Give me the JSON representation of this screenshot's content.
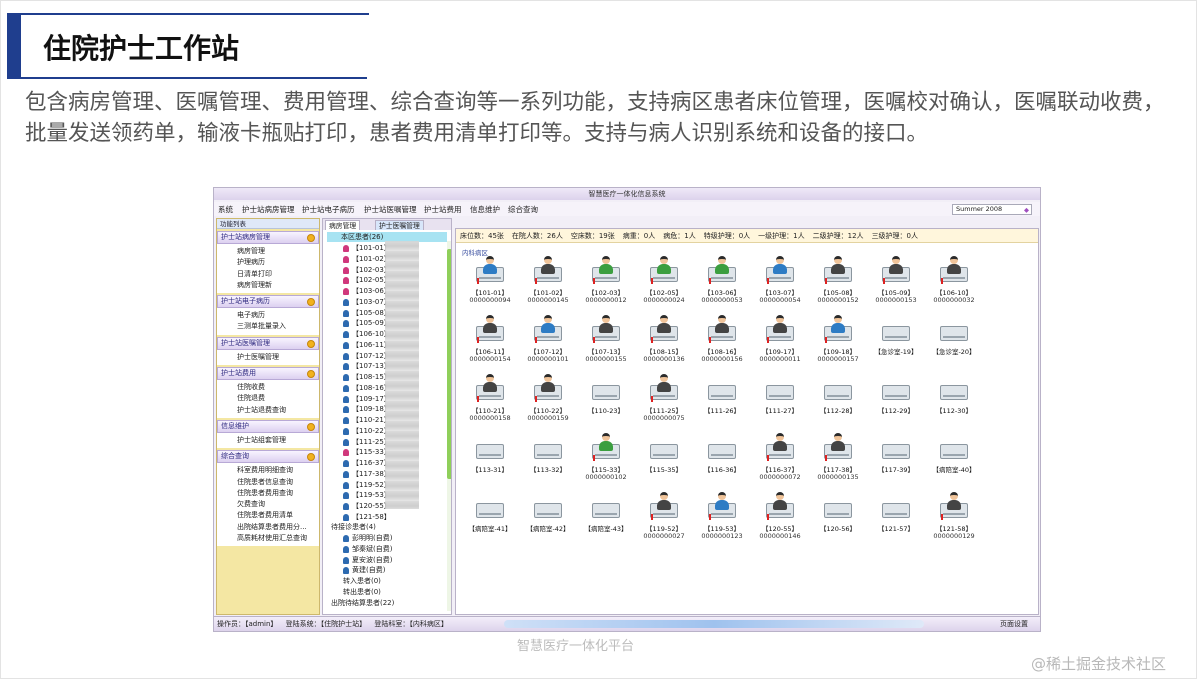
{
  "slide": {
    "title": "住院护士工作站",
    "intro": "包含病房管理、医嘱管理、费用管理、综合查询等一系列功能，支持病区患者床位管理，医嘱校对确认，医嘱联动收费，批量发送领药单，输液卡瓶贴打印，患者费用清单打印等。支持与病人识别系统和设备的接口。",
    "caption": "智慧医疗一体化平台",
    "watermark": "@稀土掘金技术社区"
  },
  "app": {
    "window_title": "智慧医疗一体化信息系统",
    "menu": [
      "系统",
      "护士站病房管理",
      "护士站电子病历",
      "护士站医嘱管理",
      "护士站费用",
      "信息维护",
      "综合查询"
    ],
    "skin_select": "Summer 2008",
    "nav_header": "功能列表",
    "nav_groups": [
      {
        "label": "护士站病房管理",
        "items": [
          "病房管理",
          "护理病历",
          "日清单打印",
          "病房管理新"
        ]
      },
      {
        "label": "护士站电子病历",
        "items": [
          "电子病历",
          "三测单批量录入"
        ]
      },
      {
        "label": "护士站医嘱管理",
        "items": [
          "护士医嘱管理"
        ]
      },
      {
        "label": "护士站费用",
        "items": [
          "住院收费",
          "住院退费",
          "护士站退费查询"
        ]
      },
      {
        "label": "信息维护",
        "items": [
          "护士站组套管理"
        ]
      },
      {
        "label": "综合查询",
        "items": [
          "科室费用明细查询",
          "住院患者信息查询",
          "住院患者费用查询",
          "欠费查询",
          "住院患者费用清单",
          "出院结算患者费用分...",
          "高质耗材使用汇总查询"
        ]
      }
    ],
    "tabs": [
      "病房管理",
      "护士医嘱管理"
    ],
    "tree": {
      "root": "本区患者(26)",
      "patients": [
        {
          "bed": "【101-01】",
          "g": "f"
        },
        {
          "bed": "【101-02】",
          "g": "f"
        },
        {
          "bed": "【102-03】",
          "g": "f"
        },
        {
          "bed": "【102-05】",
          "g": "f"
        },
        {
          "bed": "【103-06】",
          "g": "f"
        },
        {
          "bed": "【103-07】",
          "g": "m"
        },
        {
          "bed": "【105-08】",
          "g": "m"
        },
        {
          "bed": "【105-09】",
          "g": "m"
        },
        {
          "bed": "【106-10】",
          "g": "m"
        },
        {
          "bed": "【106-11】",
          "g": "m"
        },
        {
          "bed": "【107-12】",
          "g": "m"
        },
        {
          "bed": "【107-13】",
          "g": "m"
        },
        {
          "bed": "【108-15】",
          "g": "m"
        },
        {
          "bed": "【108-16】",
          "g": "m"
        },
        {
          "bed": "【109-17】",
          "g": "m"
        },
        {
          "bed": "【109-18】",
          "g": "m"
        },
        {
          "bed": "【110-21】",
          "g": "m"
        },
        {
          "bed": "【110-22】",
          "g": "m"
        },
        {
          "bed": "【111-25】",
          "g": "m"
        },
        {
          "bed": "【115-33】",
          "g": "f"
        },
        {
          "bed": "【116-37】",
          "g": "m"
        },
        {
          "bed": "【117-38】",
          "g": "m"
        },
        {
          "bed": "【119-52】",
          "g": "m"
        },
        {
          "bed": "【119-53】",
          "g": "m"
        },
        {
          "bed": "【120-55】",
          "g": "m"
        },
        {
          "bed": "【121-58】",
          "g": "m"
        }
      ],
      "pending_label": "待接诊患者(4)",
      "pending": [
        "彭明明(自费)",
        "邹秦斌(自费)",
        "夏安波(自费)",
        "黄建(自费)"
      ],
      "transfer_in": "转入患者(0)",
      "transfer_out": "转出患者(0)",
      "discharge": "出院待结算患者(22)"
    },
    "stats": [
      "床位数：45张",
      "在院人数：26人",
      "空床数：19张",
      "病重：0人",
      "病危：1人",
      "特级护理：0人",
      "一级护理：1人",
      "二级护理：12人",
      "三级护理：0人"
    ],
    "ward_label": "内科病区",
    "beds": [
      {
        "label": "【101-01】",
        "code": "0000000094",
        "occ": 2
      },
      {
        "label": "【101-02】",
        "code": "0000000145",
        "occ": 2
      },
      {
        "label": "【102-03】",
        "code": "0000000012",
        "occ": 1
      },
      {
        "label": "【102-05】",
        "code": "0000000024",
        "occ": 1
      },
      {
        "label": "【103-06】",
        "code": "0000000053",
        "occ": 1
      },
      {
        "label": "【103-07】",
        "code": "0000000054",
        "occ": 2
      },
      {
        "label": "【105-08】",
        "code": "0000000152",
        "occ": 2
      },
      {
        "label": "【105-09】",
        "code": "0000000153",
        "occ": 2
      },
      {
        "label": "【106-10】",
        "code": "0000000032",
        "occ": 2
      },
      {
        "label": "【106-11】",
        "code": "0000000154",
        "occ": 2
      },
      {
        "label": "【107-12】",
        "code": "0000000101",
        "occ": 2
      },
      {
        "label": "【107-13】",
        "code": "0000000155",
        "occ": 2
      },
      {
        "label": "【108-15】",
        "code": "0000000136",
        "occ": 2
      },
      {
        "label": "【108-16】",
        "code": "0000000156",
        "occ": 2
      },
      {
        "label": "【109-17】",
        "code": "0000000011",
        "occ": 2
      },
      {
        "label": "【109-18】",
        "code": "0000000157",
        "occ": 2
      },
      {
        "label": "【急诊室-19】",
        "code": "",
        "occ": 0
      },
      {
        "label": "【急诊室-20】",
        "code": "",
        "occ": 0
      },
      {
        "label": "【110-21】",
        "code": "0000000158",
        "occ": 2
      },
      {
        "label": "【110-22】",
        "code": "0000000159",
        "occ": 2
      },
      {
        "label": "【110-23】",
        "code": "",
        "occ": 0
      },
      {
        "label": "【111-25】",
        "code": "0000000075",
        "occ": 2
      },
      {
        "label": "【111-26】",
        "code": "",
        "occ": 0
      },
      {
        "label": "【111-27】",
        "code": "",
        "occ": 0
      },
      {
        "label": "【112-28】",
        "code": "",
        "occ": 0
      },
      {
        "label": "【112-29】",
        "code": "",
        "occ": 0
      },
      {
        "label": "【112-30】",
        "code": "",
        "occ": 0
      },
      {
        "label": "【113-31】",
        "code": "",
        "occ": 0
      },
      {
        "label": "【113-32】",
        "code": "",
        "occ": 0
      },
      {
        "label": "【115-33】",
        "code": "0000000102",
        "occ": 1
      },
      {
        "label": "【115-35】",
        "code": "",
        "occ": 0
      },
      {
        "label": "【116-36】",
        "code": "",
        "occ": 0
      },
      {
        "label": "【116-37】",
        "code": "0000000072",
        "occ": 2
      },
      {
        "label": "【117-38】",
        "code": "0000000135",
        "occ": 2
      },
      {
        "label": "【117-39】",
        "code": "",
        "occ": 0
      },
      {
        "label": "【病陪室-40】",
        "code": "",
        "occ": 0
      },
      {
        "label": "【病陪室-41】",
        "code": "",
        "occ": 0
      },
      {
        "label": "【病陪室-42】",
        "code": "",
        "occ": 0
      },
      {
        "label": "【病陪室-43】",
        "code": "",
        "occ": 0
      },
      {
        "label": "【119-52】",
        "code": "0000000027",
        "occ": 2
      },
      {
        "label": "【119-53】",
        "code": "0000000123",
        "occ": 2
      },
      {
        "label": "【120-55】",
        "code": "0000000146",
        "occ": 2
      },
      {
        "label": "【120-56】",
        "code": "",
        "occ": 0
      },
      {
        "label": "【121-57】",
        "code": "",
        "occ": 0
      },
      {
        "label": "【121-58】",
        "code": "0000000129",
        "occ": 2
      }
    ],
    "statusbar": {
      "operator": "操作员：【admin】",
      "system": "登陆系统：【住院护士站】",
      "dept": "登陆科室：【内科病区】",
      "right": "页面设置"
    }
  }
}
